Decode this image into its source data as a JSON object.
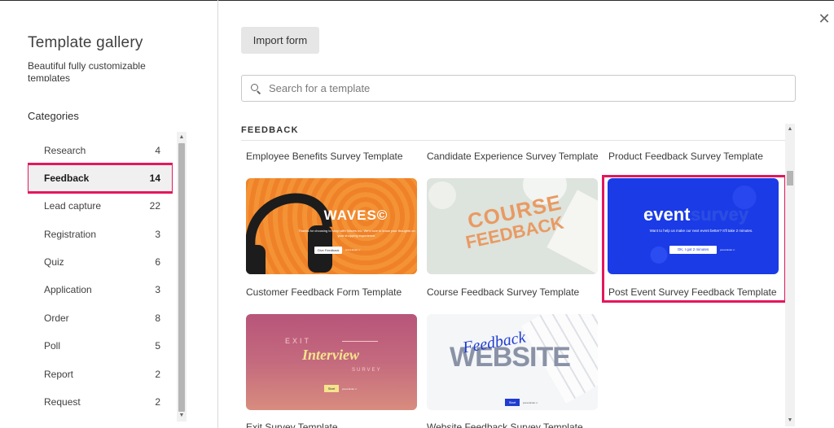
{
  "sidebar": {
    "title": "Template gallery",
    "subtitle": "Beautiful fully customizable templates",
    "categories_title": "Categories",
    "categories": [
      {
        "label": "Research",
        "count": "4"
      },
      {
        "label": "Feedback",
        "count": "14",
        "active": true
      },
      {
        "label": "Lead capture",
        "count": "22"
      },
      {
        "label": "Registration",
        "count": "3"
      },
      {
        "label": "Quiz",
        "count": "6"
      },
      {
        "label": "Application",
        "count": "3"
      },
      {
        "label": "Order",
        "count": "8"
      },
      {
        "label": "Poll",
        "count": "5"
      },
      {
        "label": "Report",
        "count": "2"
      },
      {
        "label": "Request",
        "count": "2"
      }
    ]
  },
  "toolbar": {
    "import_label": "Import form",
    "close_glyph": "✕"
  },
  "search": {
    "placeholder": "Search for a template"
  },
  "section": {
    "label": "FEEDBACK"
  },
  "templates": {
    "top_labels": [
      "Employee Benefits Survey Template",
      "Candidate Experience Survey Template",
      "Product Feedback Survey Template"
    ],
    "row1": [
      {
        "label": "Customer Feedback Form Template"
      },
      {
        "label": "Course Feedback Survey Template"
      },
      {
        "label": "Post Event Survey Feedback Template",
        "highlighted": true
      }
    ],
    "row2": [
      {
        "label": "Exit Survey Template"
      },
      {
        "label": "Website Feedback Survey Template"
      }
    ]
  },
  "cards": {
    "waves": {
      "brand": "WAVES©",
      "tiny_text": "Thanks for choosing to shop with Waves Inc. We'd love to know your thoughts on your shopping experience.",
      "button": "Give Feedback",
      "powered": "press Enter ↵"
    },
    "course": {
      "line1": "COURSE",
      "line2": "FEEDBACK"
    },
    "event": {
      "word1": "event",
      "word2": "survey",
      "tiny_text": "Want to help us make our next event better? It'll take 2 minutes.",
      "button": "OK, I got 2 minutes",
      "powered": "press Enter ↵"
    },
    "exit": {
      "word1": "EXIT",
      "word2": "Interview",
      "word3": "SURVEY",
      "button": "Start",
      "powered": "press Enter ↵"
    },
    "website": {
      "word1": "WEBSITE",
      "word2": "Feedback",
      "button": "Start",
      "powered": "press Enter ↵"
    }
  },
  "colors": {
    "highlight": "#e4175d",
    "waves_bg": "#f28a2e",
    "event_bg": "#1a3be6",
    "course_bg": "#dde3dd"
  }
}
